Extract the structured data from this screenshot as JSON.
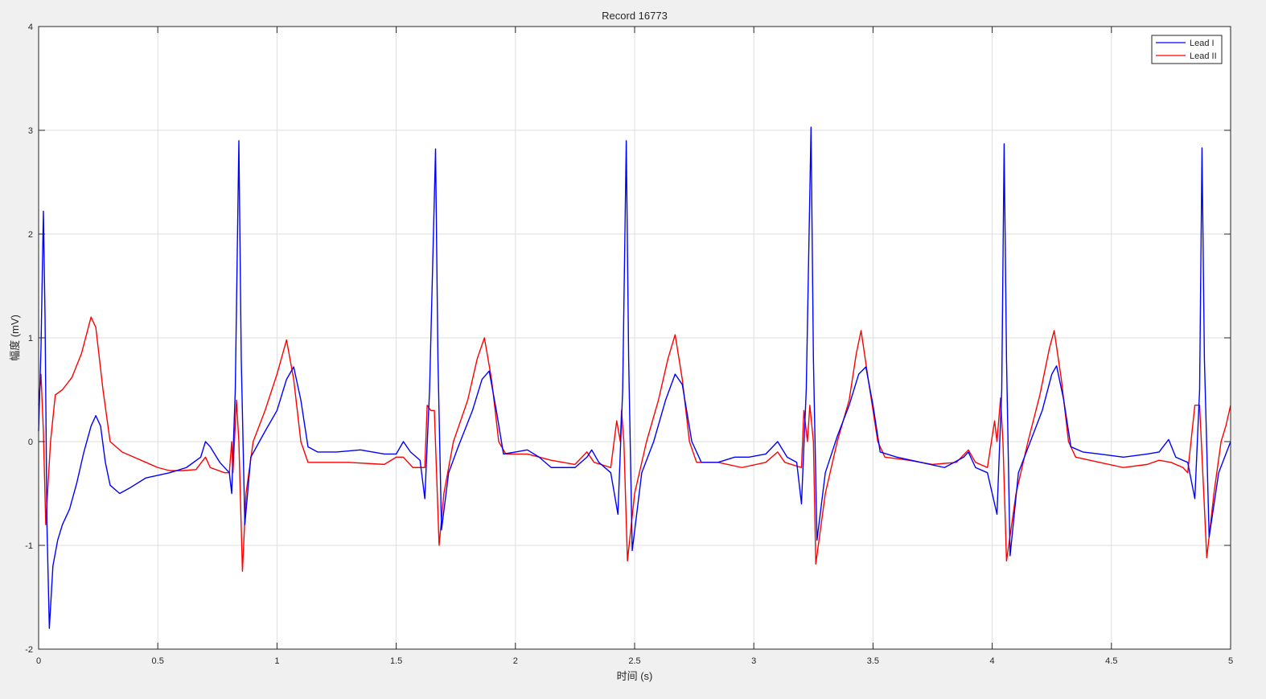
{
  "chart_data": {
    "type": "line",
    "title": "Record 16773",
    "xlabel": "时间 (s)",
    "ylabel": "幅度 (mV)",
    "xlim": [
      0,
      5
    ],
    "ylim": [
      -2,
      4
    ],
    "xticks": [
      0,
      0.5,
      1,
      1.5,
      2,
      2.5,
      3,
      3.5,
      4,
      4.5,
      5
    ],
    "xtick_labels": [
      "0",
      "0.5",
      "1",
      "1.5",
      "2",
      "2.5",
      "3",
      "3.5",
      "4",
      "4.5",
      "5"
    ],
    "yticks": [
      -2,
      -1,
      0,
      1,
      2,
      3,
      4
    ],
    "ytick_labels": [
      "-2",
      "-1",
      "0",
      "1",
      "2",
      "3",
      "4"
    ],
    "grid": true,
    "legend_position": "top-right",
    "series": [
      {
        "name": "Lead I",
        "color": "#0000ff",
        "points": [
          [
            0.0,
            0.1
          ],
          [
            0.01,
            0.9
          ],
          [
            0.02,
            2.22
          ],
          [
            0.027,
            1.2
          ],
          [
            0.035,
            -0.8
          ],
          [
            0.045,
            -1.8
          ],
          [
            0.06,
            -1.2
          ],
          [
            0.08,
            -0.95
          ],
          [
            0.1,
            -0.8
          ],
          [
            0.13,
            -0.65
          ],
          [
            0.16,
            -0.4
          ],
          [
            0.19,
            -0.1
          ],
          [
            0.22,
            0.15
          ],
          [
            0.24,
            0.25
          ],
          [
            0.26,
            0.15
          ],
          [
            0.28,
            -0.2
          ],
          [
            0.3,
            -0.42
          ],
          [
            0.34,
            -0.5
          ],
          [
            0.38,
            -0.45
          ],
          [
            0.45,
            -0.35
          ],
          [
            0.55,
            -0.3
          ],
          [
            0.62,
            -0.25
          ],
          [
            0.68,
            -0.15
          ],
          [
            0.7,
            0.0
          ],
          [
            0.72,
            -0.05
          ],
          [
            0.76,
            -0.2
          ],
          [
            0.8,
            -0.3
          ],
          [
            0.81,
            -0.5
          ],
          [
            0.825,
            0.5
          ],
          [
            0.84,
            2.9
          ],
          [
            0.85,
            0.8
          ],
          [
            0.865,
            -0.8
          ],
          [
            0.89,
            -0.15
          ],
          [
            0.95,
            0.1
          ],
          [
            1.0,
            0.3
          ],
          [
            1.04,
            0.6
          ],
          [
            1.07,
            0.72
          ],
          [
            1.1,
            0.4
          ],
          [
            1.13,
            -0.05
          ],
          [
            1.17,
            -0.1
          ],
          [
            1.25,
            -0.1
          ],
          [
            1.35,
            -0.08
          ],
          [
            1.45,
            -0.12
          ],
          [
            1.5,
            -0.12
          ],
          [
            1.53,
            0.0
          ],
          [
            1.56,
            -0.1
          ],
          [
            1.6,
            -0.18
          ],
          [
            1.62,
            -0.55
          ],
          [
            1.64,
            0.5
          ],
          [
            1.665,
            2.82
          ],
          [
            1.675,
            0.8
          ],
          [
            1.69,
            -0.85
          ],
          [
            1.72,
            -0.3
          ],
          [
            1.76,
            -0.05
          ],
          [
            1.82,
            0.3
          ],
          [
            1.86,
            0.6
          ],
          [
            1.89,
            0.68
          ],
          [
            1.92,
            0.3
          ],
          [
            1.95,
            -0.12
          ],
          [
            2.0,
            -0.1
          ],
          [
            2.05,
            -0.08
          ],
          [
            2.1,
            -0.15
          ],
          [
            2.15,
            -0.25
          ],
          [
            2.25,
            -0.25
          ],
          [
            2.3,
            -0.15
          ],
          [
            2.32,
            -0.08
          ],
          [
            2.35,
            -0.2
          ],
          [
            2.4,
            -0.3
          ],
          [
            2.43,
            -0.7
          ],
          [
            2.45,
            0.5
          ],
          [
            2.465,
            2.9
          ],
          [
            2.475,
            0.8
          ],
          [
            2.49,
            -1.05
          ],
          [
            2.53,
            -0.3
          ],
          [
            2.58,
            0.0
          ],
          [
            2.63,
            0.4
          ],
          [
            2.67,
            0.65
          ],
          [
            2.7,
            0.55
          ],
          [
            2.74,
            0.0
          ],
          [
            2.78,
            -0.2
          ],
          [
            2.85,
            -0.2
          ],
          [
            2.92,
            -0.15
          ],
          [
            2.98,
            -0.15
          ],
          [
            3.05,
            -0.12
          ],
          [
            3.1,
            0.0
          ],
          [
            3.14,
            -0.15
          ],
          [
            3.18,
            -0.2
          ],
          [
            3.2,
            -0.6
          ],
          [
            3.22,
            0.5
          ],
          [
            3.24,
            3.03
          ],
          [
            3.25,
            0.8
          ],
          [
            3.265,
            -0.95
          ],
          [
            3.3,
            -0.3
          ],
          [
            3.35,
            0.05
          ],
          [
            3.4,
            0.35
          ],
          [
            3.44,
            0.65
          ],
          [
            3.47,
            0.72
          ],
          [
            3.5,
            0.35
          ],
          [
            3.53,
            -0.1
          ],
          [
            3.6,
            -0.15
          ],
          [
            3.7,
            -0.2
          ],
          [
            3.8,
            -0.25
          ],
          [
            3.88,
            -0.15
          ],
          [
            3.9,
            -0.1
          ],
          [
            3.93,
            -0.25
          ],
          [
            3.98,
            -0.3
          ],
          [
            4.02,
            -0.7
          ],
          [
            4.04,
            0.5
          ],
          [
            4.05,
            2.87
          ],
          [
            4.06,
            0.8
          ],
          [
            4.075,
            -1.1
          ],
          [
            4.11,
            -0.3
          ],
          [
            4.16,
            0.0
          ],
          [
            4.21,
            0.3
          ],
          [
            4.25,
            0.65
          ],
          [
            4.27,
            0.73
          ],
          [
            4.3,
            0.4
          ],
          [
            4.33,
            -0.05
          ],
          [
            4.38,
            -0.1
          ],
          [
            4.45,
            -0.12
          ],
          [
            4.55,
            -0.15
          ],
          [
            4.65,
            -0.12
          ],
          [
            4.7,
            -0.1
          ],
          [
            4.74,
            0.02
          ],
          [
            4.77,
            -0.15
          ],
          [
            4.82,
            -0.2
          ],
          [
            4.85,
            -0.55
          ],
          [
            4.87,
            0.5
          ],
          [
            4.88,
            2.83
          ],
          [
            4.89,
            0.8
          ],
          [
            4.91,
            -0.92
          ],
          [
            4.95,
            -0.3
          ],
          [
            5.0,
            0.0
          ]
        ]
      },
      {
        "name": "Lead II",
        "color": "#ff0000",
        "points": [
          [
            0.0,
            0.35
          ],
          [
            0.01,
            0.65
          ],
          [
            0.02,
            0.1
          ],
          [
            0.03,
            -0.8
          ],
          [
            0.05,
            0.0
          ],
          [
            0.07,
            0.45
          ],
          [
            0.1,
            0.5
          ],
          [
            0.14,
            0.62
          ],
          [
            0.18,
            0.85
          ],
          [
            0.22,
            1.2
          ],
          [
            0.24,
            1.1
          ],
          [
            0.27,
            0.5
          ],
          [
            0.3,
            0.0
          ],
          [
            0.35,
            -0.1
          ],
          [
            0.4,
            -0.15
          ],
          [
            0.45,
            -0.2
          ],
          [
            0.5,
            -0.25
          ],
          [
            0.55,
            -0.28
          ],
          [
            0.6,
            -0.28
          ],
          [
            0.66,
            -0.27
          ],
          [
            0.7,
            -0.15
          ],
          [
            0.72,
            -0.25
          ],
          [
            0.78,
            -0.3
          ],
          [
            0.8,
            -0.3
          ],
          [
            0.81,
            0.0
          ],
          [
            0.815,
            -0.3
          ],
          [
            0.83,
            0.4
          ],
          [
            0.84,
            0.0
          ],
          [
            0.855,
            -1.25
          ],
          [
            0.87,
            -0.5
          ],
          [
            0.9,
            0.0
          ],
          [
            0.95,
            0.3
          ],
          [
            1.0,
            0.65
          ],
          [
            1.04,
            0.98
          ],
          [
            1.07,
            0.6
          ],
          [
            1.1,
            0.0
          ],
          [
            1.13,
            -0.2
          ],
          [
            1.2,
            -0.2
          ],
          [
            1.3,
            -0.2
          ],
          [
            1.45,
            -0.22
          ],
          [
            1.5,
            -0.15
          ],
          [
            1.53,
            -0.15
          ],
          [
            1.57,
            -0.25
          ],
          [
            1.62,
            -0.25
          ],
          [
            1.63,
            0.35
          ],
          [
            1.645,
            0.3
          ],
          [
            1.66,
            0.3
          ],
          [
            1.68,
            -1.0
          ],
          [
            1.7,
            -0.5
          ],
          [
            1.74,
            0.0
          ],
          [
            1.8,
            0.4
          ],
          [
            1.84,
            0.8
          ],
          [
            1.87,
            1.0
          ],
          [
            1.9,
            0.6
          ],
          [
            1.93,
            0.0
          ],
          [
            1.96,
            -0.12
          ],
          [
            2.05,
            -0.12
          ],
          [
            2.15,
            -0.18
          ],
          [
            2.25,
            -0.22
          ],
          [
            2.3,
            -0.1
          ],
          [
            2.33,
            -0.2
          ],
          [
            2.4,
            -0.25
          ],
          [
            2.425,
            0.2
          ],
          [
            2.44,
            0.0
          ],
          [
            2.445,
            0.3
          ],
          [
            2.455,
            0.0
          ],
          [
            2.47,
            -1.15
          ],
          [
            2.5,
            -0.5
          ],
          [
            2.55,
            0.0
          ],
          [
            2.6,
            0.4
          ],
          [
            2.64,
            0.8
          ],
          [
            2.67,
            1.03
          ],
          [
            2.7,
            0.6
          ],
          [
            2.73,
            0.0
          ],
          [
            2.76,
            -0.2
          ],
          [
            2.85,
            -0.2
          ],
          [
            2.95,
            -0.25
          ],
          [
            3.05,
            -0.2
          ],
          [
            3.1,
            -0.1
          ],
          [
            3.13,
            -0.2
          ],
          [
            3.2,
            -0.25
          ],
          [
            3.21,
            0.3
          ],
          [
            3.225,
            0.0
          ],
          [
            3.235,
            0.35
          ],
          [
            3.25,
            0.0
          ],
          [
            3.26,
            -1.18
          ],
          [
            3.3,
            -0.5
          ],
          [
            3.35,
            0.0
          ],
          [
            3.4,
            0.4
          ],
          [
            3.43,
            0.85
          ],
          [
            3.45,
            1.07
          ],
          [
            3.48,
            0.6
          ],
          [
            3.52,
            0.0
          ],
          [
            3.55,
            -0.15
          ],
          [
            3.65,
            -0.18
          ],
          [
            3.75,
            -0.22
          ],
          [
            3.85,
            -0.2
          ],
          [
            3.9,
            -0.08
          ],
          [
            3.93,
            -0.2
          ],
          [
            3.98,
            -0.25
          ],
          [
            4.01,
            0.2
          ],
          [
            4.02,
            0.0
          ],
          [
            4.035,
            0.42
          ],
          [
            4.045,
            0.0
          ],
          [
            4.06,
            -1.15
          ],
          [
            4.1,
            -0.5
          ],
          [
            4.15,
            0.0
          ],
          [
            4.2,
            0.45
          ],
          [
            4.24,
            0.9
          ],
          [
            4.26,
            1.07
          ],
          [
            4.29,
            0.6
          ],
          [
            4.32,
            0.0
          ],
          [
            4.35,
            -0.15
          ],
          [
            4.45,
            -0.2
          ],
          [
            4.55,
            -0.25
          ],
          [
            4.65,
            -0.22
          ],
          [
            4.7,
            -0.18
          ],
          [
            4.75,
            -0.2
          ],
          [
            4.8,
            -0.25
          ],
          [
            4.82,
            -0.3
          ],
          [
            4.85,
            0.35
          ],
          [
            4.87,
            0.35
          ],
          [
            4.9,
            -1.12
          ],
          [
            4.93,
            -0.5
          ],
          [
            4.96,
            0.0
          ],
          [
            4.98,
            0.15
          ],
          [
            5.0,
            0.35
          ]
        ]
      }
    ]
  }
}
